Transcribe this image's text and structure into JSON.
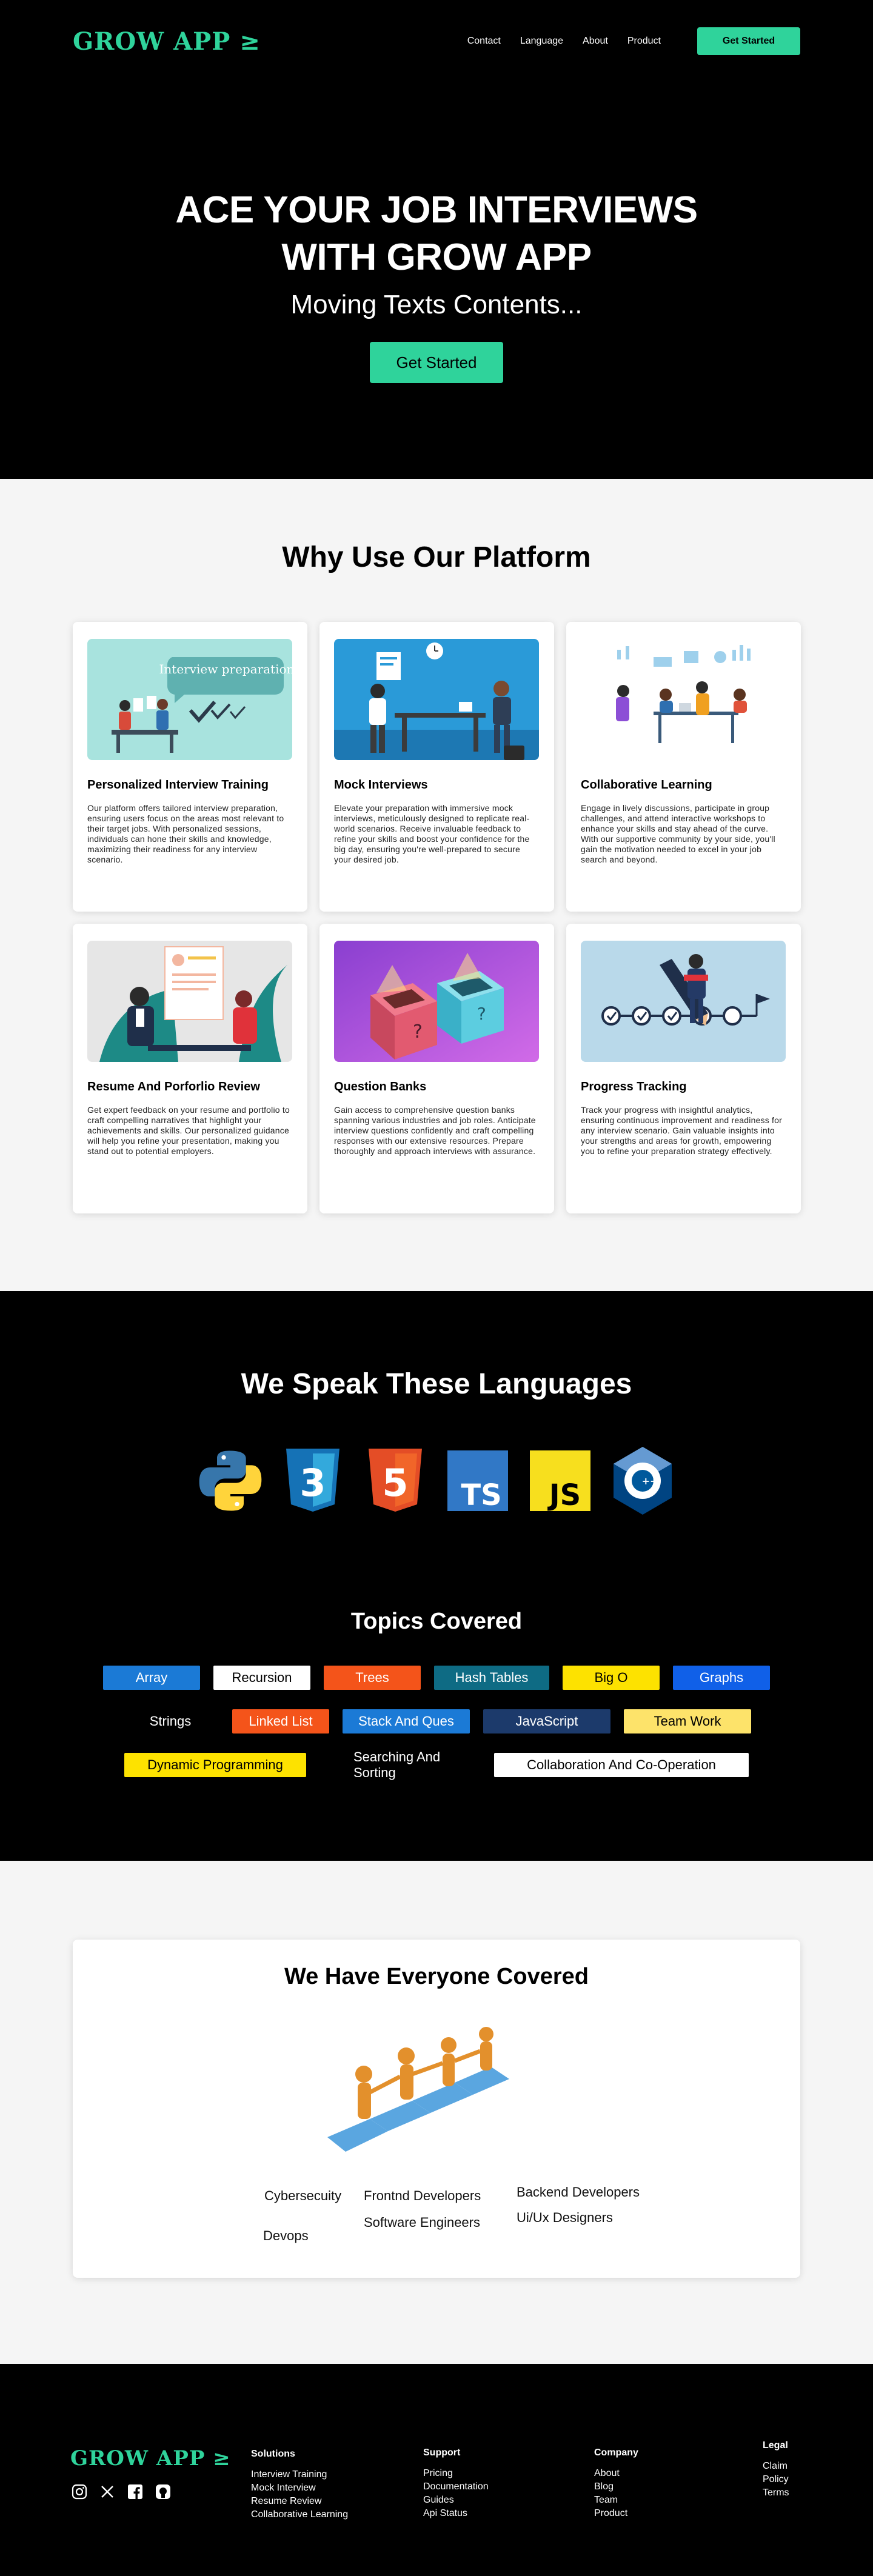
{
  "nav": {
    "logo": "GROW APP ≥",
    "links": [
      "Contact",
      "Language",
      "About",
      "Product"
    ],
    "cta": "Get Started"
  },
  "hero": {
    "title_line1": "ACE YOUR JOB INTERVIEWS",
    "title_line2": "WITH GROW APP",
    "subtitle": "Moving Texts Contents...",
    "cta": "Get Started"
  },
  "why": {
    "title": "Why Use Our Platform",
    "cards": [
      {
        "title": "Personalized  Interview Training",
        "image_caption": "Interview preparation",
        "text": "Our platform offers tailored interview preparation, ensuring users focus on the areas most relevant to their target jobs. With personalized sessions, individuals can hone their skills and knowledge, maximizing their readiness for any interview scenario."
      },
      {
        "title": "Mock Interviews",
        "text": "Elevate your preparation with immersive mock interviews, meticulously designed to replicate real-world scenarios. Receive invaluable feedback to refine your skills and boost your confidence for the big day, ensuring you're well-prepared to secure your desired job."
      },
      {
        "title": "Collaborative Learning",
        "text": "Engage in lively discussions, participate in group challenges, and attend interactive workshops to enhance your skills and stay ahead of the curve. With our supportive community by your side, you'll gain the motivation needed to excel in your job search and beyond."
      },
      {
        "title": "Resume And Porforlio Review",
        "text": "Get expert feedback on your resume and portfolio to craft compelling narratives that highlight your achievements and skills. Our personalized guidance will help you refine your presentation, making you stand out to potential employers."
      },
      {
        "title": "Question Banks",
        "text": "Gain access to comprehensive question banks spanning various industries and job roles. Anticipate interview questions confidently and craft compelling responses with our extensive resources. Prepare thoroughly and approach interviews with assurance."
      },
      {
        "title": "Progress Tracking",
        "text": "Track your progress with insightful analytics, ensuring continuous improvement and readiness for any interview scenario. Gain valuable insights into your strengths and areas for growth, empowering you to refine your preparation strategy effectively."
      }
    ]
  },
  "languages": {
    "title": "We Speak These Languages",
    "icons": [
      "python-icon",
      "css3-icon",
      "html5-icon",
      "typescript-icon",
      "javascript-icon",
      "cplusplus-icon"
    ],
    "badges": {
      "css": "3",
      "html": "5",
      "ts": "TS",
      "js": "JS",
      "cpp": "C",
      "cpp_plus": "++"
    }
  },
  "topics": {
    "title": "Topics Covered",
    "rows": [
      [
        {
          "label": "Array",
          "bg": "#1b7ad6",
          "fg": "#ffffff"
        },
        {
          "label": "Recursion",
          "bg": "#ffffff",
          "fg": "#000000"
        },
        {
          "label": "Trees",
          "bg": "#f4541a",
          "fg": "#ffffff"
        },
        {
          "label": "Hash Tables",
          "bg": "#0e6b84",
          "fg": "#ffffff"
        },
        {
          "label": "Big O",
          "bg": "#fde200",
          "fg": "#000000"
        },
        {
          "label": "Graphs",
          "bg": "#1060e8",
          "fg": "#ffffff"
        }
      ],
      [
        {
          "label": "Strings",
          "bg": "#000000",
          "fg": "#ffffff"
        },
        {
          "label": "Linked List",
          "bg": "#f4541a",
          "fg": "#ffffff"
        },
        {
          "label": "Stack And Ques",
          "bg": "#1b7ad6",
          "fg": "#ffffff"
        },
        {
          "label": "JavaScript",
          "bg": "#1c3a6b",
          "fg": "#ffffff"
        },
        {
          "label": "Team Work",
          "bg": "#fde36a",
          "fg": "#000000"
        }
      ],
      [
        {
          "label": "Dynamic Programming",
          "bg": "#fde200",
          "fg": "#000000"
        },
        {
          "label": "Searching And Sorting",
          "bg": "#000000",
          "fg": "#ffffff"
        },
        {
          "label": "Collaboration And Co-Operation",
          "bg": "#ffffff",
          "fg": "#000000"
        }
      ]
    ]
  },
  "covered": {
    "title": "We Have Everyone Covered",
    "roles": [
      "Cybersecuity",
      "Devops",
      "Frontnd Developers",
      "Software Engineers",
      "Backend Developers",
      "Ui/Ux Designers"
    ]
  },
  "footer": {
    "logo": "GROW APP ≥",
    "social": [
      "instagram-icon",
      "x-icon",
      "facebook-icon",
      "github-icon"
    ],
    "columns": [
      {
        "heading": "Solutions",
        "links": [
          "Interview Training",
          "Mock Interview",
          "Resume Review",
          "Collaborative Learning"
        ]
      },
      {
        "heading": "Support",
        "links": [
          "Pricing",
          "Documentation",
          "Guides",
          "Api Status"
        ]
      },
      {
        "heading": "Company",
        "links": [
          "About",
          "Blog",
          "Team",
          "Product"
        ]
      },
      {
        "heading": "Legal",
        "links": [
          "Claim",
          "Policy",
          "Terms"
        ]
      }
    ]
  },
  "colors": {
    "accent": "#2fd39b",
    "dark": "#000000",
    "light": "#f5f5f5"
  }
}
